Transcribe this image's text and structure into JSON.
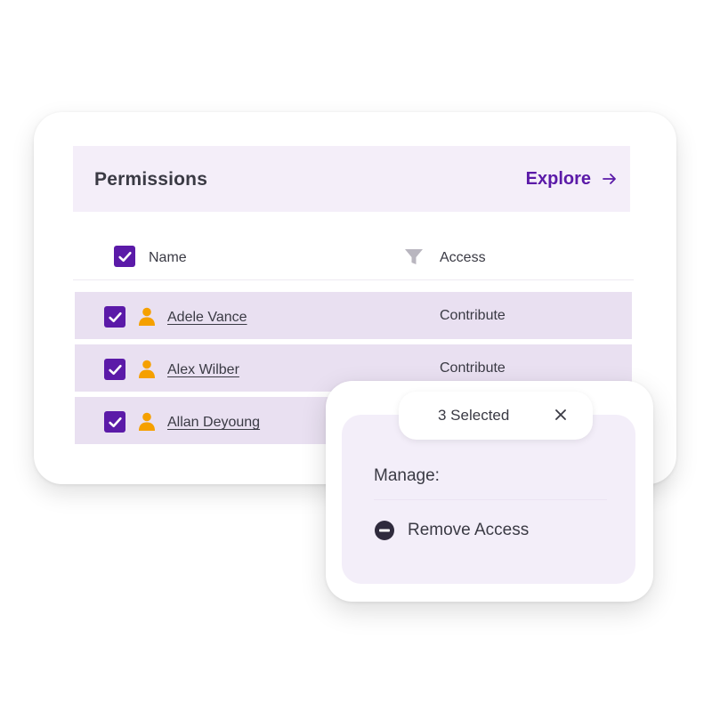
{
  "permissions": {
    "title": "Permissions",
    "explore_label": "Explore",
    "explore_icon": "arrow-right-icon",
    "columns": {
      "name": "Name",
      "access": "Access"
    },
    "header_checkbox_checked": true,
    "rows": [
      {
        "name": "Adele Vance",
        "access": "Contribute",
        "checked": true
      },
      {
        "name": "Alex Wilber",
        "access": "Contribute",
        "checked": true
      },
      {
        "name": "Allan Deyoung",
        "access": "",
        "checked": true
      }
    ]
  },
  "selection": {
    "count_label": "3 Selected",
    "manage_label": "Manage:",
    "remove_label": "Remove Access"
  },
  "colors": {
    "accent": "#5b1aa8",
    "header_bg": "#f4eef9",
    "row_bg": "#e9e0f1",
    "person_icon": "#f5a000",
    "popover_bg": "#f3eef9"
  }
}
